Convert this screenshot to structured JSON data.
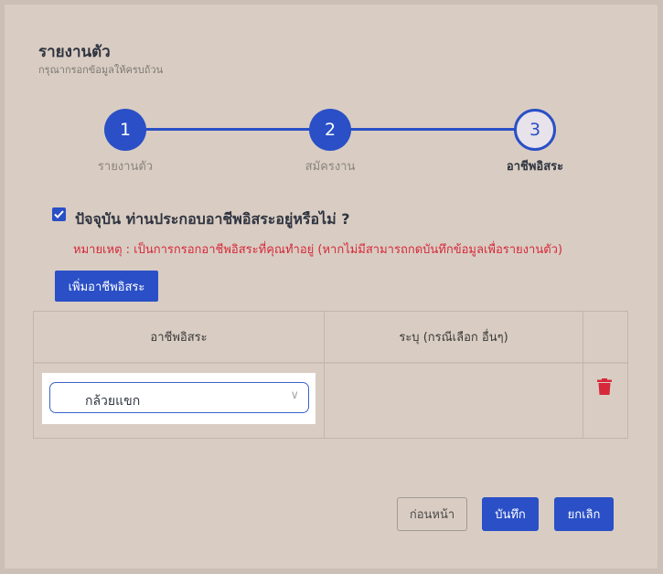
{
  "header": {
    "title": "รายงานตัว",
    "subtitle": "กรุณากรอกข้อมูลให้ครบถ้วน"
  },
  "stepper": {
    "steps": [
      {
        "number": "1",
        "label": "รายงานตัว",
        "state": "done"
      },
      {
        "number": "2",
        "label": "สมัครงาน",
        "state": "done"
      },
      {
        "number": "3",
        "label": "อาชีพอิสระ",
        "state": "active"
      }
    ]
  },
  "freelance": {
    "checkbox_checked": true,
    "question": "ปัจจุบัน ท่านประกอบอาชีพอิสระอยู่หรือไม่ ?",
    "note": "หมายเหตุ : เป็นการกรอกอาชีพอิสระที่คุณทำอยู่ (หากไม่มีสามารถกดบันทึกข้อมูลเพื่อรายงานตัว)",
    "add_button": "เพิ่มอาชีพอิสระ"
  },
  "table": {
    "columns": [
      "อาชีพอิสระ",
      "ระบุ (กรณีเลือก อื่นๆ)",
      ""
    ],
    "rows": [
      {
        "occupation": "กล้วยแขก",
        "specify": "",
        "delete_icon": "trash-icon"
      }
    ]
  },
  "footer": {
    "prev_label": "ก่อนหน้า",
    "save_label": "บันทึก",
    "cancel_label": "ยกเลิก"
  },
  "colors": {
    "accent": "#2a4fc6",
    "danger": "#d6283a",
    "background": "#d9cdc3"
  }
}
